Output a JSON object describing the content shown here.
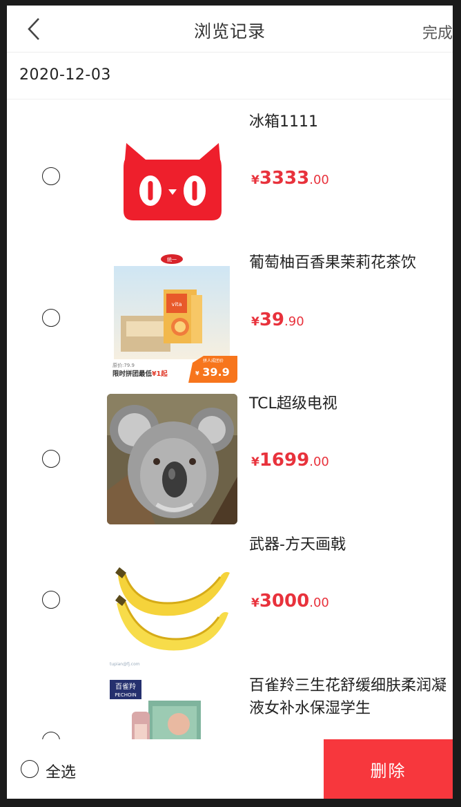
{
  "header": {
    "title": "浏览记录",
    "done_label": "完成"
  },
  "date_label": "2020-12-03",
  "items": [
    {
      "name": "冰箱1111",
      "currency": "¥",
      "price_int": "3333",
      "price_dec": ".00",
      "image": "tmall-cat-logo"
    },
    {
      "name": "葡萄柚百香果茉莉花茶饮",
      "currency": "¥",
      "price_int": "39",
      "price_dec": ".90",
      "image": "tea-drink-product",
      "image_texts": {
        "brand_badge": "统一",
        "box_label": "vita",
        "orig_price": "原价:79.9",
        "promo": "限时拼团最低",
        "promo_price": "¥1起",
        "tag_top": "拼人成团价",
        "tag_currency": "¥",
        "tag_price": "39.9"
      }
    },
    {
      "name": "TCL超级电视",
      "currency": "¥",
      "price_int": "1699",
      "price_dec": ".00",
      "image": "koala-photo"
    },
    {
      "name": "武器-方天画戟",
      "currency": "¥",
      "price_int": "3000",
      "price_dec": ".00",
      "image": "banana-photo",
      "image_caption": "tupian@fj.com"
    },
    {
      "name": "百雀羚三生花舒缓细肤柔润凝液女补水保湿学生",
      "currency": "¥",
      "price_int": "",
      "price_dec": "",
      "image": "pechoin-product",
      "image_texts": {
        "brand_cn": "百雀羚",
        "brand_en": "PECHOIN"
      }
    }
  ],
  "footer": {
    "select_all_label": "全选",
    "delete_label": "删除"
  },
  "colors": {
    "price_red": "#e8323c",
    "delete_button": "#f7373d",
    "tmall_red": "#ee1f2c"
  }
}
